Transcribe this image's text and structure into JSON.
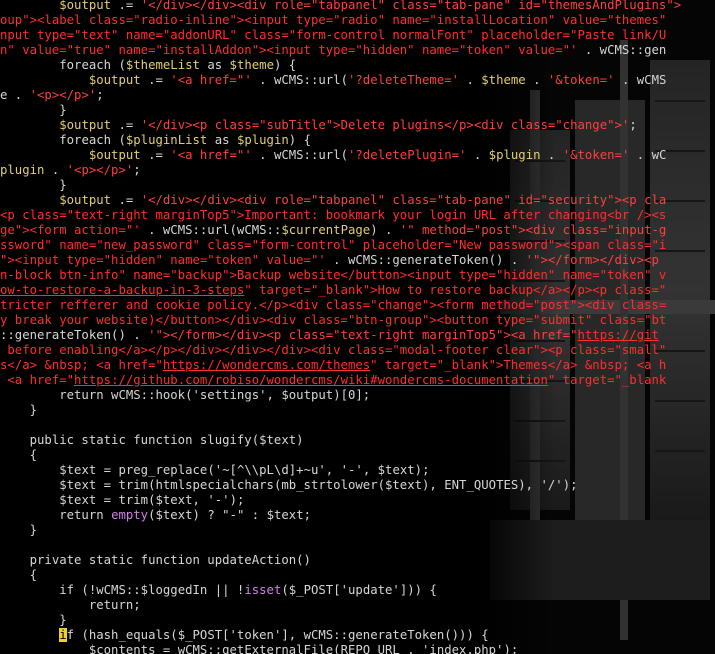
{
  "editor": {
    "lines": [
      [
        {
          "t": "        ",
          "c": "default"
        },
        {
          "t": "$output",
          "c": "var"
        },
        {
          "t": " .= ",
          "c": "op"
        },
        {
          "t": "'</div></div><div role=\"tabpanel\" class=\"tab-pane\" id=\"themesAndPlugins\">",
          "c": "str"
        }
      ],
      [
        {
          "t": "oup\"><label class=\"radio-inline\"><input type=\"radio\" name=\"installLocation\" value=\"themes\"",
          "c": "html"
        }
      ],
      [
        {
          "t": "nput type=\"text\" name=\"addonURL\" class=\"form-control normalFont\" placeholder=\"Paste link/U",
          "c": "html"
        }
      ],
      [
        {
          "t": "n\" value=\"true\" name=\"installAddon\"><input type=\"hidden\" name=\"token\" value=\"' ",
          "c": "html"
        },
        {
          "t": ". wCMS::gen",
          "c": "default"
        }
      ],
      [
        {
          "t": "        ",
          "c": "default"
        },
        {
          "t": "foreach",
          "c": "kw"
        },
        {
          "t": " (",
          "c": "punct"
        },
        {
          "t": "$themeList",
          "c": "var"
        },
        {
          "t": " as ",
          "c": "kw"
        },
        {
          "t": "$theme",
          "c": "var"
        },
        {
          "t": ") {",
          "c": "punct"
        }
      ],
      [
        {
          "t": "            ",
          "c": "default"
        },
        {
          "t": "$output",
          "c": "var"
        },
        {
          "t": " .= ",
          "c": "op"
        },
        {
          "t": "'<a href=\"' ",
          "c": "str"
        },
        {
          "t": ". wCMS::url(",
          "c": "default"
        },
        {
          "t": "'?deleteTheme='",
          "c": "str"
        },
        {
          "t": " . ",
          "c": "op"
        },
        {
          "t": "$theme",
          "c": "var"
        },
        {
          "t": " . ",
          "c": "op"
        },
        {
          "t": "'&token='",
          "c": "str"
        },
        {
          "t": " . wCMS",
          "c": "default"
        }
      ],
      [
        {
          "t": "e . ",
          "c": "default"
        },
        {
          "t": "'<p></p>'",
          "c": "str"
        },
        {
          "t": ";",
          "c": "punct"
        }
      ],
      [
        {
          "t": "        }",
          "c": "punct"
        }
      ],
      [
        {
          "t": "        ",
          "c": "default"
        },
        {
          "t": "$output",
          "c": "var"
        },
        {
          "t": " .= ",
          "c": "op"
        },
        {
          "t": "'</div><p class=\"subTitle\">Delete plugins</p><div class=\"change\">'",
          "c": "str"
        },
        {
          "t": ";",
          "c": "punct"
        }
      ],
      [
        {
          "t": "        ",
          "c": "default"
        },
        {
          "t": "foreach",
          "c": "kw"
        },
        {
          "t": " (",
          "c": "punct"
        },
        {
          "t": "$pluginList",
          "c": "var"
        },
        {
          "t": " as ",
          "c": "kw"
        },
        {
          "t": "$plugin",
          "c": "var"
        },
        {
          "t": ") {",
          "c": "punct"
        }
      ],
      [
        {
          "t": "            ",
          "c": "default"
        },
        {
          "t": "$output",
          "c": "var"
        },
        {
          "t": " .= ",
          "c": "op"
        },
        {
          "t": "'<a href=\"' ",
          "c": "str"
        },
        {
          "t": ". wCMS::url(",
          "c": "default"
        },
        {
          "t": "'?deletePlugin='",
          "c": "str"
        },
        {
          "t": " . ",
          "c": "op"
        },
        {
          "t": "$plugin",
          "c": "var"
        },
        {
          "t": " . ",
          "c": "op"
        },
        {
          "t": "'&token='",
          "c": "str"
        },
        {
          "t": " . wC",
          "c": "default"
        }
      ],
      [
        {
          "t": "plugin",
          "c": "var"
        },
        {
          "t": " . ",
          "c": "op"
        },
        {
          "t": "'<p></p>'",
          "c": "str"
        },
        {
          "t": ";",
          "c": "punct"
        }
      ],
      [
        {
          "t": "        }",
          "c": "punct"
        }
      ],
      [
        {
          "t": "        ",
          "c": "default"
        },
        {
          "t": "$output",
          "c": "var"
        },
        {
          "t": " .= ",
          "c": "op"
        },
        {
          "t": "'</div></div><div role=\"tabpanel\" class=\"tab-pane\" id=\"security\"><p cla",
          "c": "str"
        }
      ],
      [
        {
          "t": "<p class=\"text-right marginTop5\">Important: bookmark your login URL after changing<br /><s",
          "c": "html"
        }
      ],
      [
        {
          "t": "ge\"><form action=\"' ",
          "c": "html"
        },
        {
          "t": ". wCMS::url(wCMS::",
          "c": "default"
        },
        {
          "t": "$currentPage",
          "c": "var"
        },
        {
          "t": ") . ",
          "c": "default"
        },
        {
          "t": "'\" method=\"post\"><div class=\"input-g",
          "c": "str"
        }
      ],
      [
        {
          "t": "ssword\" name=\"new_password\" class=\"form-control\" placeholder=\"New password\"><span class=\"i",
          "c": "html"
        }
      ],
      [
        {
          "t": "\"><input type=\"hidden\" name=\"token\" value=\"' ",
          "c": "html"
        },
        {
          "t": ". wCMS::generateToken() . ",
          "c": "default"
        },
        {
          "t": "'\"></form></div><p",
          "c": "str"
        }
      ],
      [
        {
          "t": "n-block btn-info\" name=\"backup\">Backup website</button><input type=\"hidden\" name=\"token\" v",
          "c": "html"
        }
      ],
      [
        {
          "t": "ow-to-restore-a-backup-in-3-steps",
          "c": "url"
        },
        {
          "t": "\" target=\"_blank\">How to restore backup</a></p><p class=\"",
          "c": "html"
        }
      ],
      [
        {
          "t": "tricter refferer and cookie policy.</p><div class=\"change\"><form method=\"post\"><div class=",
          "c": "html"
        }
      ],
      [
        {
          "t": "y break your website)</button></div><div class=\"btn-group\"><button type=\"submit\" class=\"bt",
          "c": "html"
        }
      ],
      [
        {
          "t": "::generateToken() . ",
          "c": "default"
        },
        {
          "t": "'\"></form></div><p class=\"text-right marginTop5\"><a href=\"",
          "c": "str"
        },
        {
          "t": "https://git",
          "c": "url"
        }
      ],
      [
        {
          "t": " before enabling</a></p></div></div></div><div class=\"modal-footer clear\"><p class=\"small\"",
          "c": "html"
        }
      ],
      [
        {
          "t": "s</a> &nbsp; <a href=\"",
          "c": "html"
        },
        {
          "t": "https://wondercms.com/themes",
          "c": "url"
        },
        {
          "t": "\" target=\"_blank\">Themes</a> &nbsp; <a h",
          "c": "html"
        }
      ],
      [
        {
          "t": " <a href=\"",
          "c": "html"
        },
        {
          "t": "https://github.com/robiso/wondercms/wiki#wondercms-documentation",
          "c": "url"
        },
        {
          "t": "\" target=\"_blank",
          "c": "html"
        }
      ],
      [
        {
          "t": "        return wCMS::hook(",
          "c": "default"
        },
        {
          "t": "'settings'",
          "c": "default"
        },
        {
          "t": ", ",
          "c": "punct"
        },
        {
          "t": "$output",
          "c": "default"
        },
        {
          "t": ")[0];",
          "c": "punct"
        }
      ],
      [
        {
          "t": "    }",
          "c": "punct"
        }
      ],
      [
        {
          "t": "",
          "c": "default"
        }
      ],
      [
        {
          "t": "    public static function slugify(",
          "c": "default"
        },
        {
          "t": "$text",
          "c": "default"
        },
        {
          "t": ")",
          "c": "punct"
        }
      ],
      [
        {
          "t": "    {",
          "c": "punct"
        }
      ],
      [
        {
          "t": "        ",
          "c": "default"
        },
        {
          "t": "$text",
          "c": "default"
        },
        {
          "t": " = preg_replace(",
          "c": "default"
        },
        {
          "t": "'~[^\\\\pL\\d]+~u'",
          "c": "default"
        },
        {
          "t": ", ",
          "c": "punct"
        },
        {
          "t": "'-'",
          "c": "default"
        },
        {
          "t": ", ",
          "c": "punct"
        },
        {
          "t": "$text",
          "c": "default"
        },
        {
          "t": ");",
          "c": "punct"
        }
      ],
      [
        {
          "t": "        ",
          "c": "default"
        },
        {
          "t": "$text",
          "c": "default"
        },
        {
          "t": " = trim(htmlspecialchars(mb_strtolower(",
          "c": "default"
        },
        {
          "t": "$text",
          "c": "default"
        },
        {
          "t": "), ENT_QUOTES), ",
          "c": "default"
        },
        {
          "t": "'/'",
          "c": "default"
        },
        {
          "t": ");",
          "c": "punct"
        }
      ],
      [
        {
          "t": "        ",
          "c": "default"
        },
        {
          "t": "$text",
          "c": "default"
        },
        {
          "t": " = trim(",
          "c": "default"
        },
        {
          "t": "$text",
          "c": "default"
        },
        {
          "t": ", ",
          "c": "punct"
        },
        {
          "t": "'-'",
          "c": "default"
        },
        {
          "t": ");",
          "c": "punct"
        }
      ],
      [
        {
          "t": "        return ",
          "c": "default"
        },
        {
          "t": "empty",
          "c": "builtin"
        },
        {
          "t": "(",
          "c": "punct"
        },
        {
          "t": "$text",
          "c": "default"
        },
        {
          "t": ") ? ",
          "c": "default"
        },
        {
          "t": "\"-\"",
          "c": "default"
        },
        {
          "t": " : ",
          "c": "default"
        },
        {
          "t": "$text",
          "c": "default"
        },
        {
          "t": ";",
          "c": "punct"
        }
      ],
      [
        {
          "t": "    }",
          "c": "punct"
        }
      ],
      [
        {
          "t": "",
          "c": "default"
        }
      ],
      [
        {
          "t": "    private static function updateAction()",
          "c": "default"
        }
      ],
      [
        {
          "t": "    {",
          "c": "punct"
        }
      ],
      [
        {
          "t": "        if (!wCMS::",
          "c": "default"
        },
        {
          "t": "$loggedIn",
          "c": "default"
        },
        {
          "t": " || !",
          "c": "default"
        },
        {
          "t": "isset",
          "c": "builtin"
        },
        {
          "t": "(",
          "c": "punct"
        },
        {
          "t": "$_POST",
          "c": "default"
        },
        {
          "t": "[",
          "c": "punct"
        },
        {
          "t": "'update'",
          "c": "default"
        },
        {
          "t": "])) {",
          "c": "punct"
        }
      ],
      [
        {
          "t": "            return;",
          "c": "default"
        }
      ],
      [
        {
          "t": "        }",
          "c": "punct"
        }
      ],
      [
        {
          "t": "        ",
          "c": "default"
        },
        {
          "t": "i",
          "c": "cursor"
        },
        {
          "t": "f (hash_equals(",
          "c": "default"
        },
        {
          "t": "$_POST",
          "c": "default"
        },
        {
          "t": "[",
          "c": "punct"
        },
        {
          "t": "'token'",
          "c": "default"
        },
        {
          "t": "], wCMS::generateToken())) {",
          "c": "default"
        }
      ],
      [
        {
          "t": "            ",
          "c": "default"
        },
        {
          "t": "$contents",
          "c": "default"
        },
        {
          "t": " = wCMS::getExternalFile(REPO_URL . ",
          "c": "default"
        },
        {
          "t": "'index.php'",
          "c": "default"
        },
        {
          "t": ");",
          "c": "punct"
        }
      ]
    ]
  }
}
